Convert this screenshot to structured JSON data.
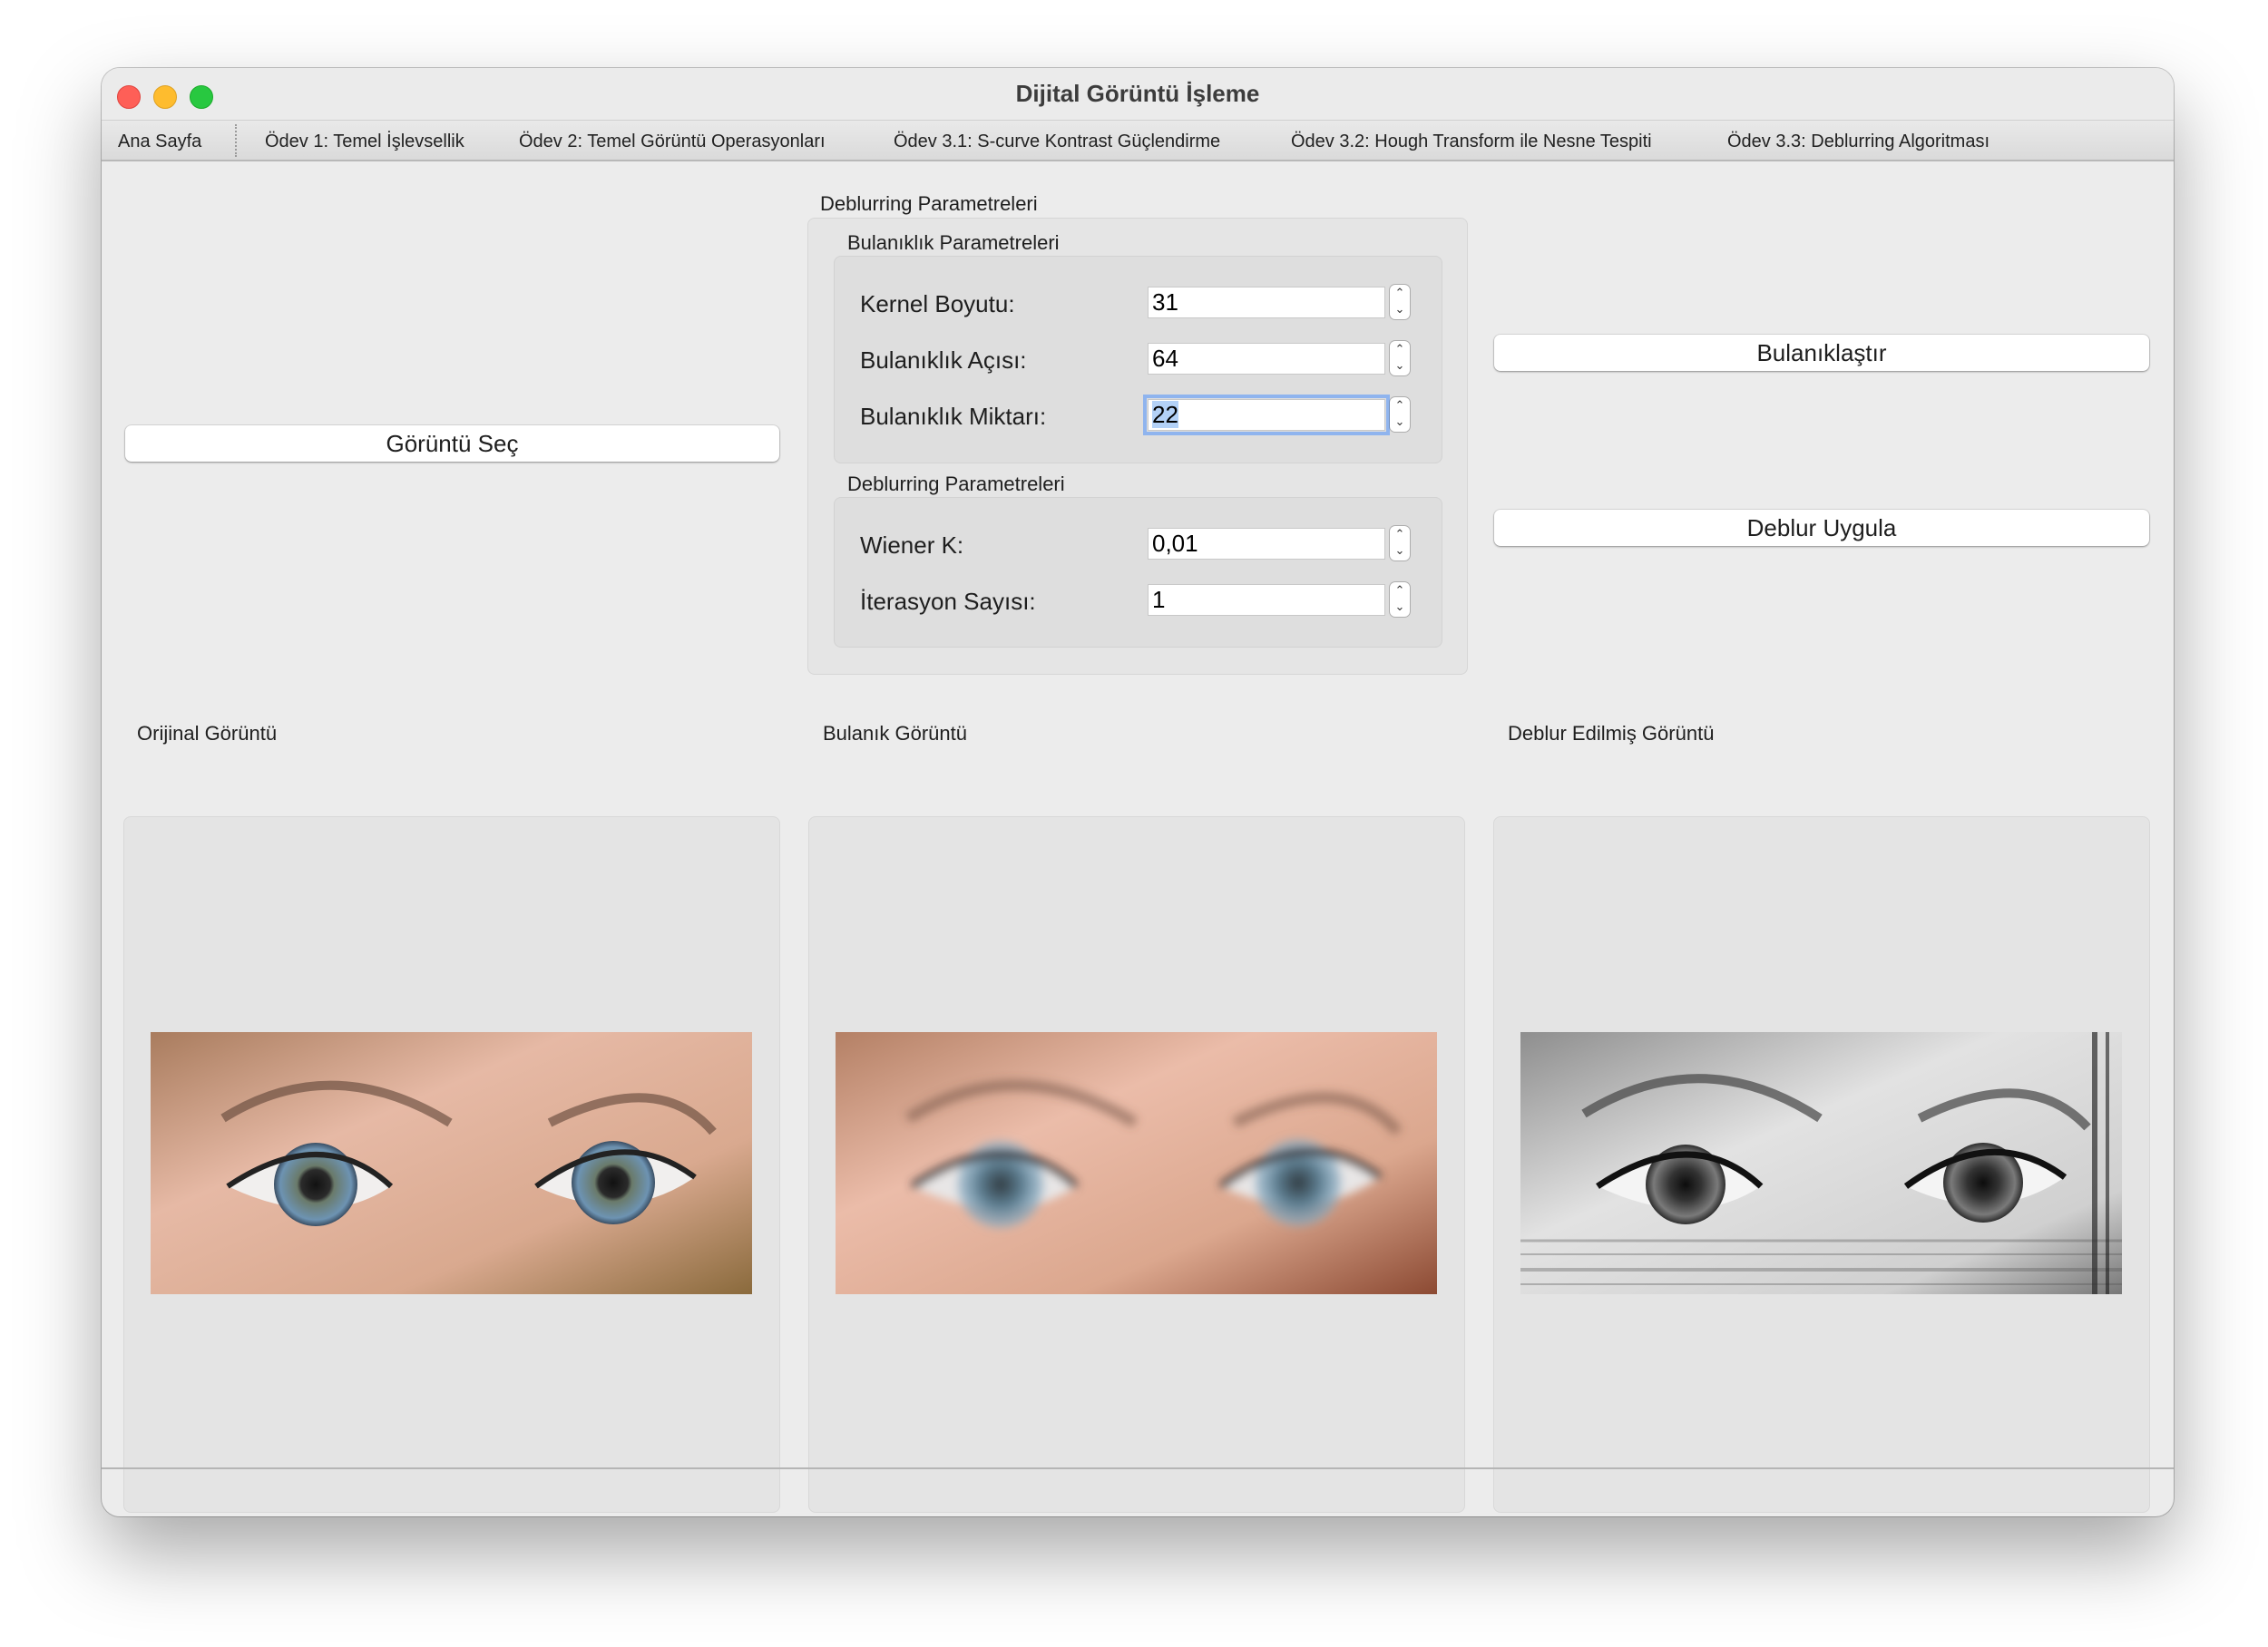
{
  "window": {
    "title": "Dijital Görüntü İşleme"
  },
  "tabs": [
    "Ana Sayfa",
    "Ödev 1: Temel İşlevsellik",
    "Ödev 2: Temel Görüntü Operasyonları",
    "Ödev 3.1: S-curve Kontrast Güçlendirme",
    "Ödev 3.2: Hough Transform ile Nesne Tespiti",
    "Ödev 3.3: Deblurring Algoritması"
  ],
  "buttons": {
    "select_image": "Görüntü Seç",
    "blur": "Bulanıklaştır",
    "deblur": "Deblur Uygula"
  },
  "params": {
    "title": "Deblurring Parametreleri",
    "blur_group": {
      "title": "Bulanıklık Parametreleri",
      "kernel_label": "Kernel Boyutu:",
      "kernel_value": "31",
      "angle_label": "Bulanıklık Açısı:",
      "angle_value": "64",
      "amount_label": "Bulanıklık Miktarı:",
      "amount_value": "22"
    },
    "deblur_group": {
      "title": "Deblurring Parametreleri",
      "wiener_label": "Wiener K:",
      "wiener_value": "0,01",
      "iter_label": "İterasyon Sayısı:",
      "iter_value": "1"
    }
  },
  "panels": {
    "original": "Orijinal Görüntü",
    "blurred": "Bulanık Görüntü",
    "deblurred": "Deblur Edilmiş Görüntü"
  },
  "colors": {
    "close": "#fe5f57",
    "minimize": "#febc2e",
    "maximize": "#28c840",
    "focus_ring": "#8fb4ee"
  }
}
